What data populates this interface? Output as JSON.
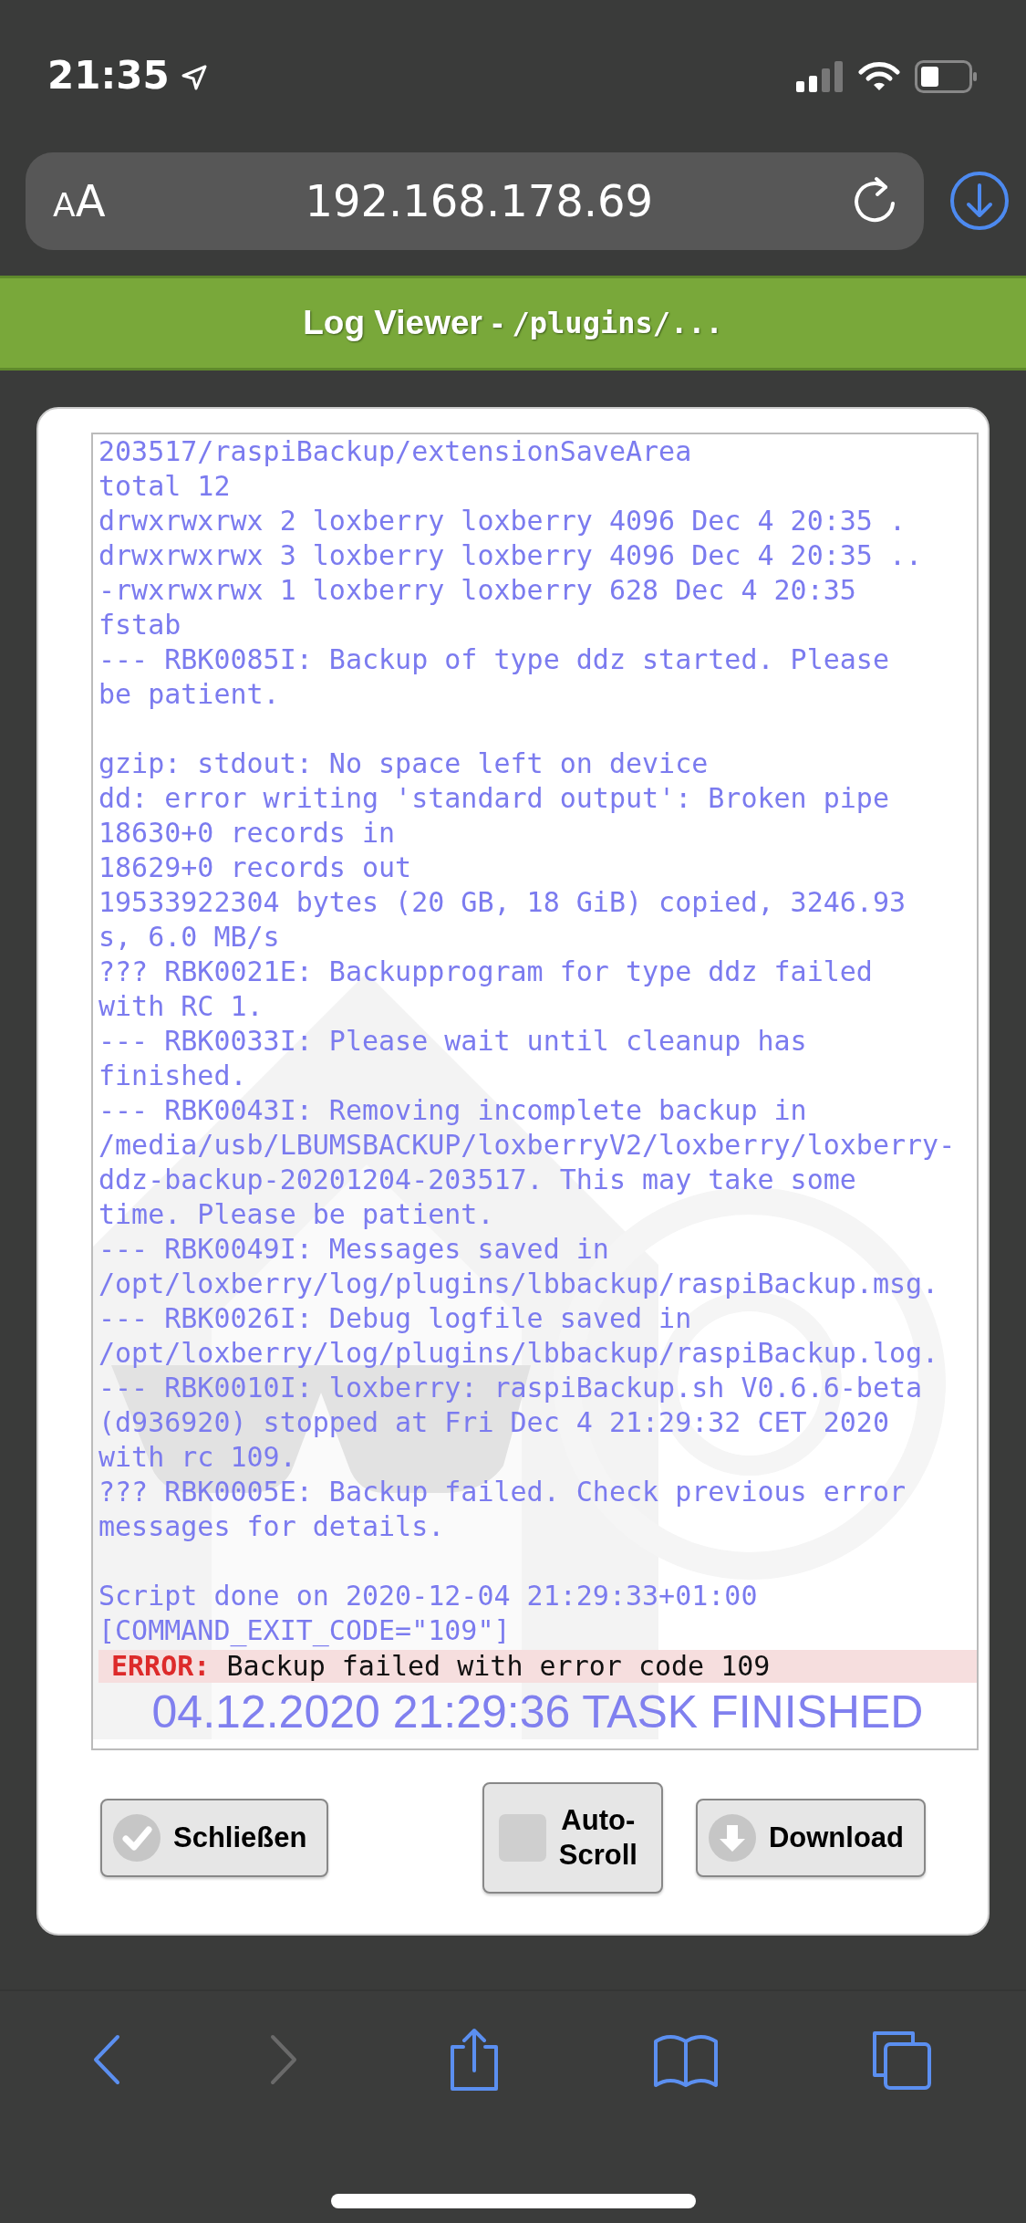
{
  "status_bar": {
    "time": "21:35"
  },
  "address_bar": {
    "text_size_button": "AA",
    "url": "192.168.178.69"
  },
  "header": {
    "title": "Log Viewer -",
    "path": "/plugins/..."
  },
  "log": {
    "blocks": [
      [
        "203517/raspiBackup/extensionSaveArea",
        "total 12",
        "drwxrwxrwx 2 loxberry loxberry 4096 Dec 4 20:35 .",
        "drwxrwxrwx 3 loxberry loxberry 4096 Dec 4 20:35 ..",
        "-rwxrwxrwx 1 loxberry loxberry 628 Dec 4 20:35\nfstab",
        "--- RBK0085I: Backup of type ddz started. Please\nbe patient."
      ],
      [
        "gzip: stdout: No space left on device",
        "dd: error writing 'standard output': Broken pipe",
        "18630+0 records in",
        "18629+0 records out",
        "19533922304 bytes (20 GB, 18 GiB) copied, 3246.93\ns, 6.0 MB/s",
        "??? RBK0021E: Backupprogram for type ddz failed\nwith RC 1.",
        "--- RBK0033I: Please wait until cleanup has\nfinished.",
        "--- RBK0043I: Removing incomplete backup in\n/media/usb/LBUMSBACKUP/loxberryV2/loxberry/loxberry-\nddz-backup-20201204-203517. This may take some\ntime. Please be patient.",
        "--- RBK0049I: Messages saved in\n/opt/loxberry/log/plugins/lbbackup/raspiBackup.msg.",
        "--- RBK0026I: Debug logfile saved in\n/opt/loxberry/log/plugins/lbbackup/raspiBackup.log.",
        "--- RBK0010I: loxberry: raspiBackup.sh V0.6.6-beta\n(d936920) stopped at Fri Dec 4 21:29:32 CET 2020\nwith rc 109.",
        "??? RBK0005E: Backup failed. Check previous error\nmessages for details."
      ],
      [
        "Script done on 2020-12-04 21:29:33+01:00",
        "[COMMAND_EXIT_CODE=\"109\"]"
      ]
    ],
    "error": {
      "label": "ERROR:",
      "message": "Backup failed with error code 109"
    },
    "finished": "04.12.2020 21:29:36 TASK FINISHED"
  },
  "buttons": [
    {
      "kind": "close",
      "label": "Schließen"
    },
    {
      "kind": "toggle",
      "label": "Auto-\nScroll",
      "checked": false
    },
    {
      "kind": "download",
      "label": "Download"
    }
  ],
  "toolbar": [
    {
      "kind": "back",
      "disabled": false
    },
    {
      "kind": "forward",
      "disabled": true
    },
    {
      "kind": "share",
      "disabled": false
    },
    {
      "kind": "bookmarks",
      "disabled": false
    },
    {
      "kind": "tabs",
      "disabled": false
    }
  ]
}
